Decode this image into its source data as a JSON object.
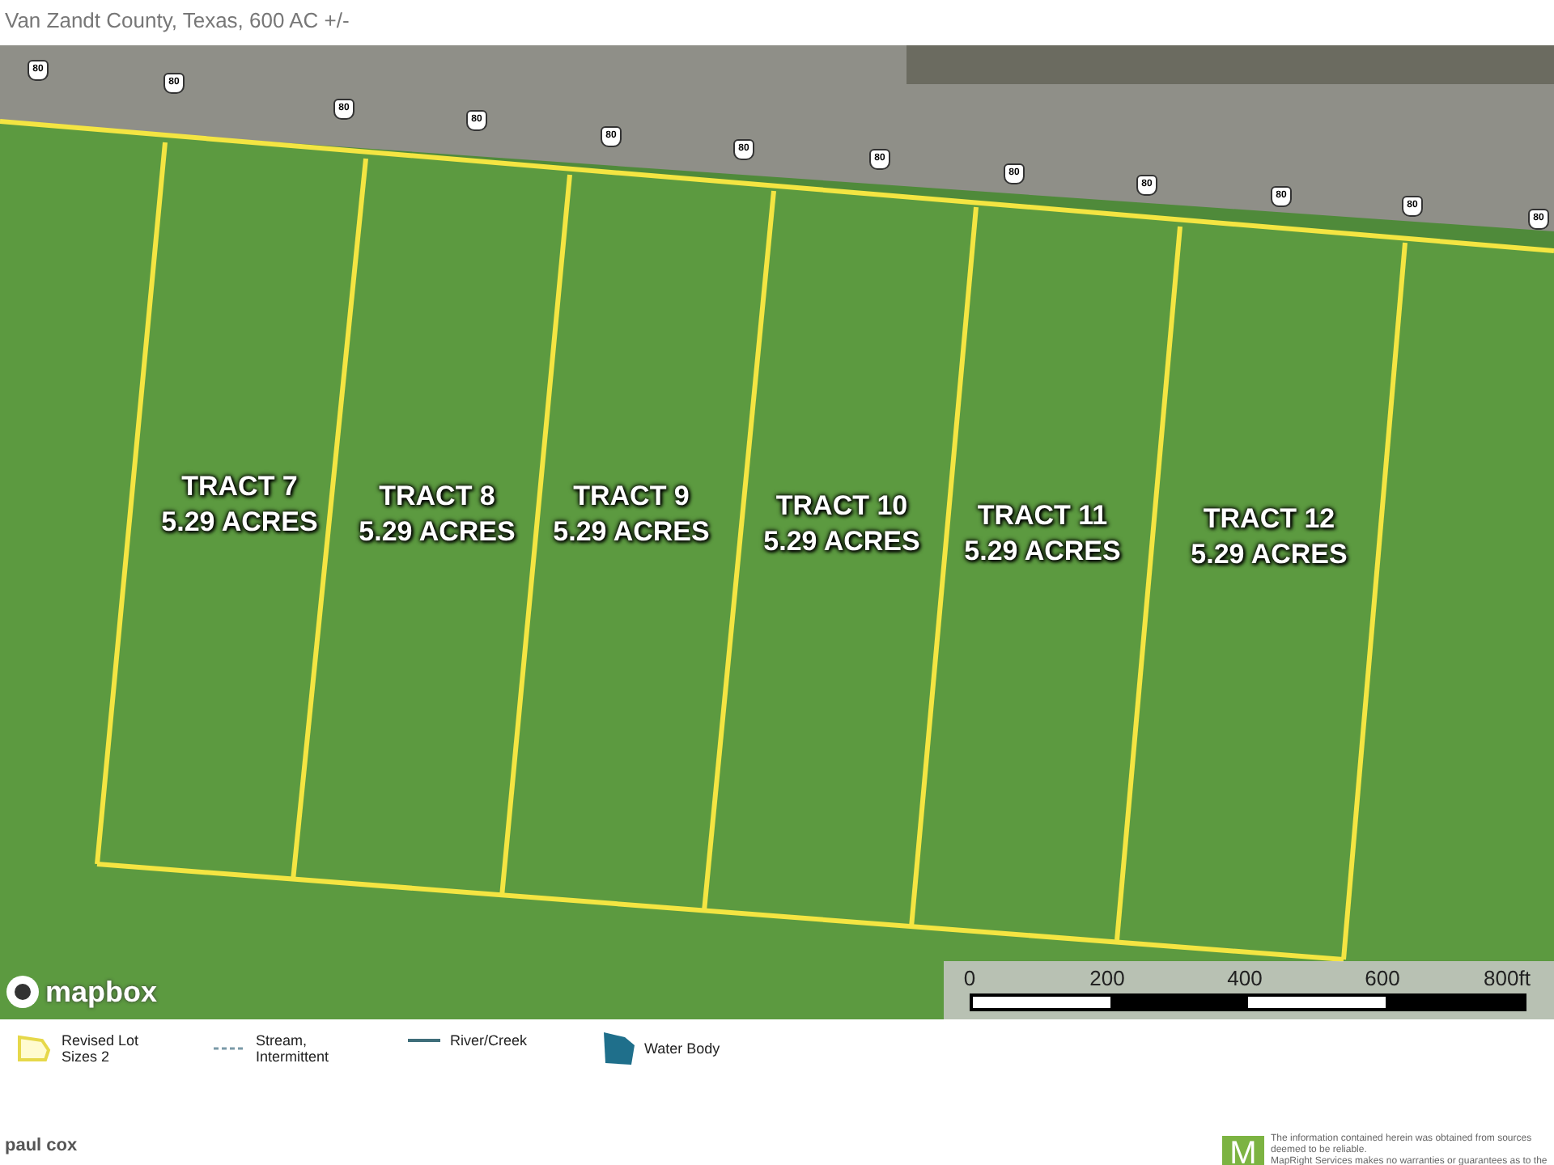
{
  "header": {
    "subtitle": "Van Zandt County, Texas, 600 AC +/-"
  },
  "map": {
    "route_shields": [
      "80",
      "80",
      "80",
      "80",
      "80",
      "80",
      "80",
      "80",
      "80",
      "80",
      "80",
      "80"
    ],
    "tracts": [
      {
        "name": "TRACT 7",
        "area": "5.29 ACRES"
      },
      {
        "name": "TRACT 8",
        "area": "5.29 ACRES"
      },
      {
        "name": "TRACT 9",
        "area": "5.29 ACRES"
      },
      {
        "name": "TRACT 10",
        "area": "5.29 ACRES"
      },
      {
        "name": "TRACT 11",
        "area": "5.29 ACRES"
      },
      {
        "name": "TRACT 12",
        "area": "5.29 ACRES"
      }
    ],
    "attribution": "mapbox",
    "scale_bar": {
      "labels": [
        "0",
        "200",
        "400",
        "600",
        "800ft"
      ]
    }
  },
  "legend": [
    {
      "kind": "polygon",
      "label": "Revised Lot Sizes 2"
    },
    {
      "kind": "dashed",
      "label": "Stream, Intermittent"
    },
    {
      "kind": "line",
      "label": "River/Creek"
    },
    {
      "kind": "fill",
      "label": "Water Body"
    }
  ],
  "footer": {
    "name": "paul cox",
    "logo_letter": "M",
    "disclaimer": [
      "The information contained herein was obtained from sources deemed to be reliable.",
      "MapRight Services makes no warranties or guarantees as to the"
    ]
  }
}
